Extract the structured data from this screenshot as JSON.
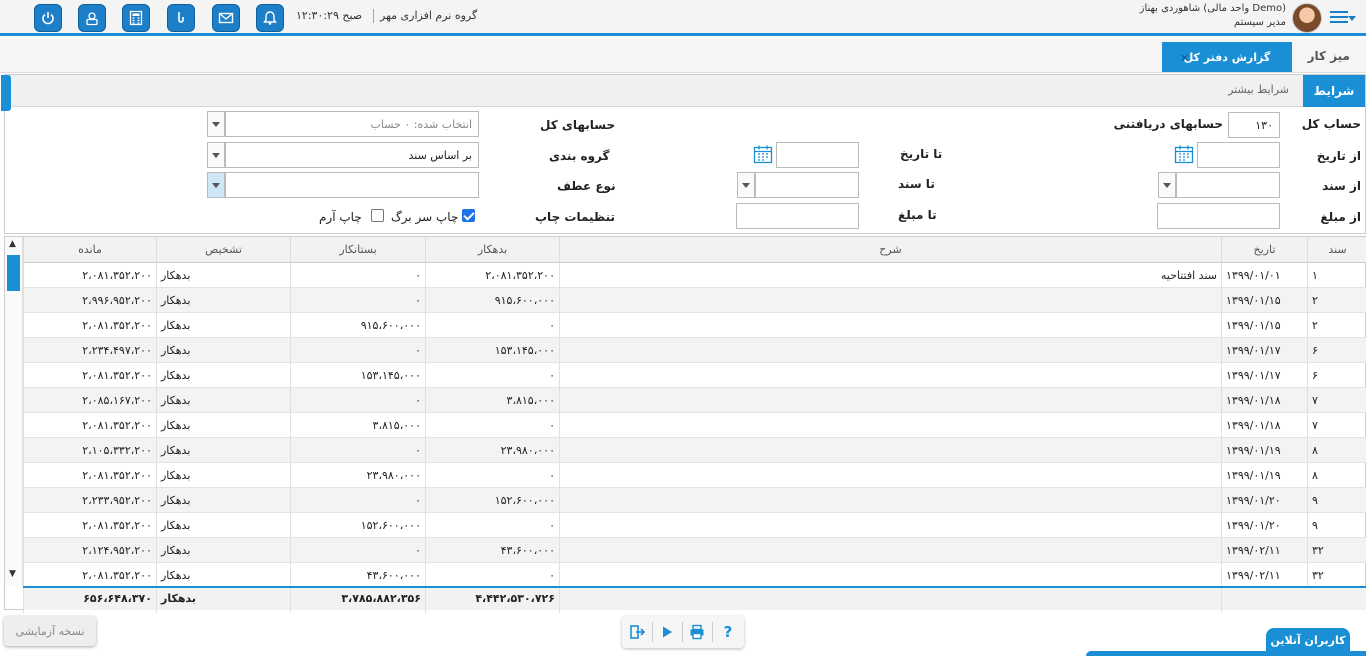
{
  "header": {
    "user_name": "شاهوردی بهناز (واحد مالی Demo)",
    "user_role": "مدیر سیستم",
    "company": "گروه نرم افزاری مهر",
    "clock": "۱۲:۳۰:۲۹ صبح"
  },
  "tabs": {
    "desk": "میز کار",
    "active": "گزارش دفتر کل",
    "close": "×"
  },
  "conditions": {
    "tab_conditions": "شرایط",
    "tab_more": "شرایط بیشتر",
    "account_label": "حساب کل",
    "account_code": "۱۳۰",
    "account_name": "حسابهای دریافتنی",
    "accounts_label": "حسابهای کل",
    "accounts_value": "انتخاب شده: ۰ حساب",
    "from_date_label": "از تاریخ",
    "from_date_value": "",
    "to_date_label": "تا تاریخ",
    "to_date_value": "",
    "grouping_label": "گروه بندی",
    "grouping_value": "بر اساس سند",
    "from_doc_label": "از سند",
    "from_doc_value": "",
    "to_doc_label": "تا سند",
    "to_doc_value": "",
    "ref_type_label": "نوع عطف",
    "ref_type_value": "",
    "from_amount_label": "از مبلغ",
    "from_amount_value": "",
    "to_amount_label": "تا مبلغ",
    "to_amount_value": "",
    "print_settings_label": "تنظیمات چاپ",
    "print_header_label": "چاپ سر برگ",
    "print_header_checked": true,
    "print_logo_label": "چاپ آرم",
    "print_logo_checked": false
  },
  "table": {
    "headers": {
      "doc": "سند",
      "date": "تاریخ",
      "desc": "شرح",
      "debit": "بدهکار",
      "credit": "بستانکار",
      "status": "تشخیص",
      "balance": "مانده"
    },
    "rows": [
      {
        "doc": "۱",
        "date": "۱۳۹۹/۰۱/۰۱",
        "desc": "سند افتتاحیه",
        "debit": "۲،۰۸۱،۳۵۲،۲۰۰",
        "credit": "۰",
        "status": "بدهکار",
        "balance": "۲،۰۸۱،۳۵۲،۲۰۰"
      },
      {
        "doc": "۲",
        "date": "۱۳۹۹/۰۱/۱۵",
        "desc": "",
        "debit": "۹۱۵،۶۰۰،۰۰۰",
        "credit": "۰",
        "status": "بدهکار",
        "balance": "۲،۹۹۶،۹۵۲،۲۰۰"
      },
      {
        "doc": "۲",
        "date": "۱۳۹۹/۰۱/۱۵",
        "desc": "",
        "debit": "۰",
        "credit": "۹۱۵،۶۰۰،۰۰۰",
        "status": "بدهکار",
        "balance": "۲،۰۸۱،۳۵۲،۲۰۰"
      },
      {
        "doc": "۶",
        "date": "۱۳۹۹/۰۱/۱۷",
        "desc": "",
        "debit": "۱۵۳،۱۴۵،۰۰۰",
        "credit": "۰",
        "status": "بدهکار",
        "balance": "۲،۲۳۴،۴۹۷،۲۰۰"
      },
      {
        "doc": "۶",
        "date": "۱۳۹۹/۰۱/۱۷",
        "desc": "",
        "debit": "۰",
        "credit": "۱۵۳،۱۴۵،۰۰۰",
        "status": "بدهکار",
        "balance": "۲،۰۸۱،۳۵۲،۲۰۰"
      },
      {
        "doc": "۷",
        "date": "۱۳۹۹/۰۱/۱۸",
        "desc": "",
        "debit": "۳،۸۱۵،۰۰۰",
        "credit": "۰",
        "status": "بدهکار",
        "balance": "۲،۰۸۵،۱۶۷،۲۰۰"
      },
      {
        "doc": "۷",
        "date": "۱۳۹۹/۰۱/۱۸",
        "desc": "",
        "debit": "۰",
        "credit": "۳،۸۱۵،۰۰۰",
        "status": "بدهکار",
        "balance": "۲،۰۸۱،۳۵۲،۲۰۰"
      },
      {
        "doc": "۸",
        "date": "۱۳۹۹/۰۱/۱۹",
        "desc": "",
        "debit": "۲۳،۹۸۰،۰۰۰",
        "credit": "۰",
        "status": "بدهکار",
        "balance": "۲،۱۰۵،۳۳۲،۲۰۰"
      },
      {
        "doc": "۸",
        "date": "۱۳۹۹/۰۱/۱۹",
        "desc": "",
        "debit": "۰",
        "credit": "۲۳،۹۸۰،۰۰۰",
        "status": "بدهکار",
        "balance": "۲،۰۸۱،۳۵۲،۲۰۰"
      },
      {
        "doc": "۹",
        "date": "۱۳۹۹/۰۱/۲۰",
        "desc": "",
        "debit": "۱۵۲،۶۰۰،۰۰۰",
        "credit": "۰",
        "status": "بدهکار",
        "balance": "۲،۲۳۳،۹۵۲،۲۰۰"
      },
      {
        "doc": "۹",
        "date": "۱۳۹۹/۰۱/۲۰",
        "desc": "",
        "debit": "۰",
        "credit": "۱۵۲،۶۰۰،۰۰۰",
        "status": "بدهکار",
        "balance": "۲،۰۸۱،۳۵۲،۲۰۰"
      },
      {
        "doc": "۳۲",
        "date": "۱۳۹۹/۰۲/۱۱",
        "desc": "",
        "debit": "۴۳،۶۰۰،۰۰۰",
        "credit": "۰",
        "status": "بدهکار",
        "balance": "۲،۱۲۴،۹۵۲،۲۰۰"
      },
      {
        "doc": "۳۲",
        "date": "۱۳۹۹/۰۲/۱۱",
        "desc": "",
        "debit": "۰",
        "credit": "۴۳،۶۰۰،۰۰۰",
        "status": "بدهکار",
        "balance": "۲،۰۸۱،۳۵۲،۲۰۰"
      }
    ],
    "footer": {
      "debit": "۴،۴۴۲،۵۳۰،۷۲۶",
      "credit": "۳،۷۸۵،۸۸۲،۳۵۶",
      "status": "بدهکار",
      "balance": "۶۵۶،۶۴۸،۳۷۰"
    }
  },
  "bottom": {
    "demo_badge": "نسخه آزمایشی",
    "online_users": "کاربران آنلاین",
    "help": "?"
  },
  "colors": {
    "accent": "#1a8fd6",
    "button": "#1c7fc8"
  }
}
